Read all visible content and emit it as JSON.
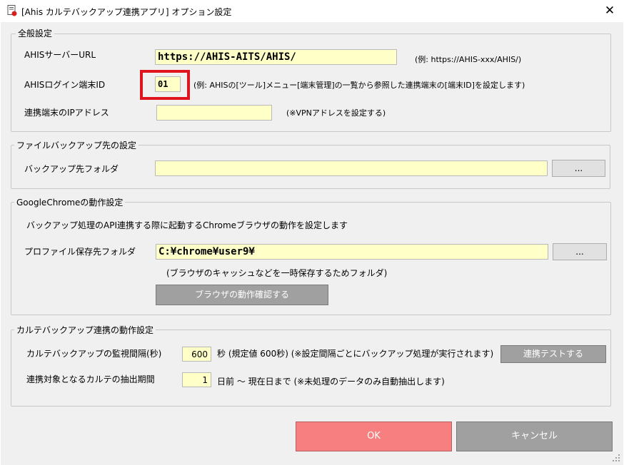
{
  "window": {
    "title": "[Ahis カルテバックアップ連携アプリ] オプション設定",
    "close_icon": "close-icon"
  },
  "general": {
    "legend": "全般設定",
    "server_url_label": "AHISサーバーURL",
    "server_url_value": "https://AHIS-AITS/AHIS/",
    "server_url_hint": "(例: https://AHIS-xxx/AHIS/)",
    "login_id_label": "AHISログイン端末ID",
    "login_id_value": "01",
    "login_id_hint": "(例: AHISの[ツール]メニュー[端末管理]の一覧から参照した連携端末の[端末ID]を設定します)",
    "ip_label": "連携端末のIPアドレス",
    "ip_value": "",
    "ip_hint": "(※VPNアドレスを設定する)"
  },
  "backup": {
    "legend": "ファイルバックアップ先の設定",
    "folder_label": "バックアップ先フォルダ",
    "folder_value": "",
    "browse_label": "..."
  },
  "chrome": {
    "legend": "GoogleChromeの動作設定",
    "description": "バックアップ処理のAPI連携する際に起動するChromeブラウザの動作を設定します",
    "profile_label": "プロファイル保存先フォルダ",
    "profile_value": "C:¥chrome¥user9¥",
    "browse_label": "...",
    "profile_hint": "(ブラウザのキャッシュなどを一時保存するためフォルダ)",
    "check_button": "ブラウザの動作確認する"
  },
  "sync": {
    "legend": "カルテバックアップ連携の動作設定",
    "interval_label": "カルテバックアップの監視間隔(秒)",
    "interval_value": "600",
    "interval_hint": "秒 (規定値 600秒) (※設定間隔ごとにバックアップ処理が実行されます)",
    "test_button": "連携テストする",
    "period_label": "連携対象となるカルテの抽出期間",
    "period_value": "1",
    "period_hint": "日前 〜 現在日まで (※未処理のデータのみ自動抽出します)"
  },
  "footer": {
    "ok_label": "OK",
    "cancel_label": "キャンセル"
  },
  "colors": {
    "input_bg": "#ffffc8",
    "highlight": "#e0141e",
    "ok_bg": "#f87f7f",
    "cancel_bg": "#a0a0a0"
  }
}
